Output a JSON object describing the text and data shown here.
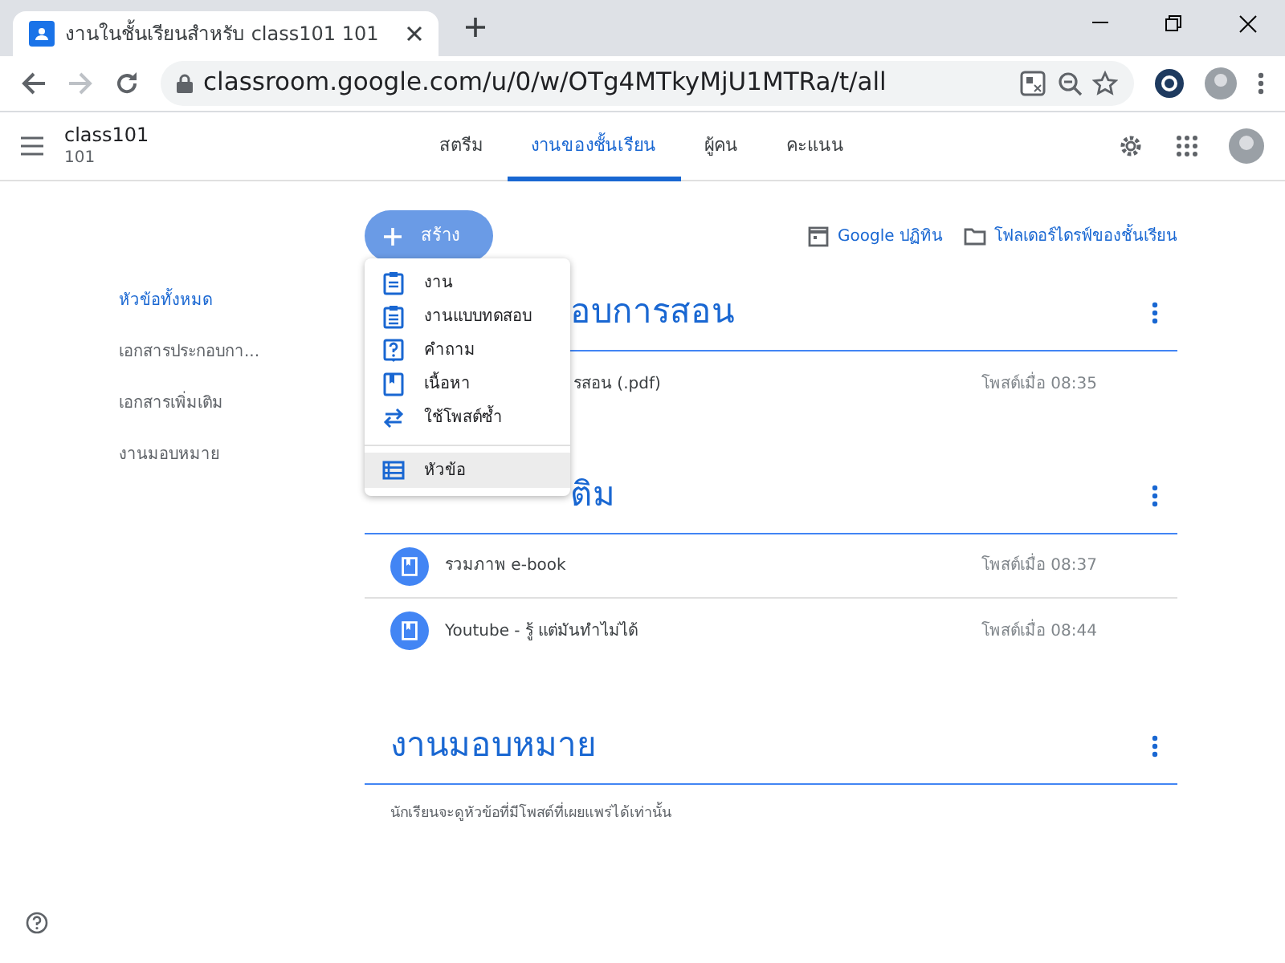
{
  "browser": {
    "tab_title": "งานในชั้นเรียนสำหรับ class101 101",
    "address": "classroom.google.com/u/0/w/OTg4MTkyMjU1MTRa/t/all"
  },
  "app": {
    "class_name": "class101",
    "class_section": "101",
    "tabs": [
      {
        "label": "สตรีม",
        "selected": false
      },
      {
        "label": "งานของชั้นเรียน",
        "selected": true
      },
      {
        "label": "ผู้คน",
        "selected": false
      },
      {
        "label": "คะแนน",
        "selected": false
      }
    ]
  },
  "create_button": "สร้าง",
  "links": [
    {
      "kind": "calendar",
      "label": "Google ปฏิทิน"
    },
    {
      "kind": "folder",
      "label": "โฟลเดอร์ไดรฟ์ของชั้นเรียน"
    }
  ],
  "topics": [
    {
      "label": "หัวข้อทั้งหมด",
      "selected": true
    },
    {
      "label": "เอกสารประกอบกา...",
      "selected": false
    },
    {
      "label": "เอกสารเพิ่มเติม",
      "selected": false
    },
    {
      "label": "งานมอบหมาย",
      "selected": false
    }
  ],
  "menu": [
    {
      "kind": "assignment",
      "label": "งาน",
      "selected": false
    },
    {
      "kind": "quiz",
      "label": "งานแบบทดสอบ",
      "selected": false
    },
    {
      "kind": "question",
      "label": "คำถาม",
      "selected": false
    },
    {
      "kind": "material",
      "label": "เนื้อหา",
      "selected": false
    },
    {
      "kind": "reuse",
      "label": "ใช้โพสต์ซ้ำ",
      "selected": false
    },
    {
      "kind": "topic",
      "label": "หัวข้อ",
      "selected": true
    }
  ],
  "sections": [
    {
      "title": "อบการสอน",
      "covered": true,
      "items": [
        {
          "title": "รสอน (.pdf)",
          "time": "โพสต์เมื่อ 08:35",
          "covered": true
        }
      ]
    },
    {
      "title": "ติม",
      "covered": true,
      "items": [
        {
          "title": "รวมภาพ e-book",
          "time": "โพสต์เมื่อ 08:37",
          "covered": false
        },
        {
          "title": "Youtube - รู้ แต่มันทำไม่ได้",
          "time": "โพสต์เมื่อ 08:44",
          "covered": false
        }
      ]
    },
    {
      "title": "งานมอบหมาย",
      "covered": false,
      "note": "นักเรียนจะดูหัวข้อที่มีโพสต์ที่เผยแพร่ได้เท่านั้น"
    }
  ]
}
